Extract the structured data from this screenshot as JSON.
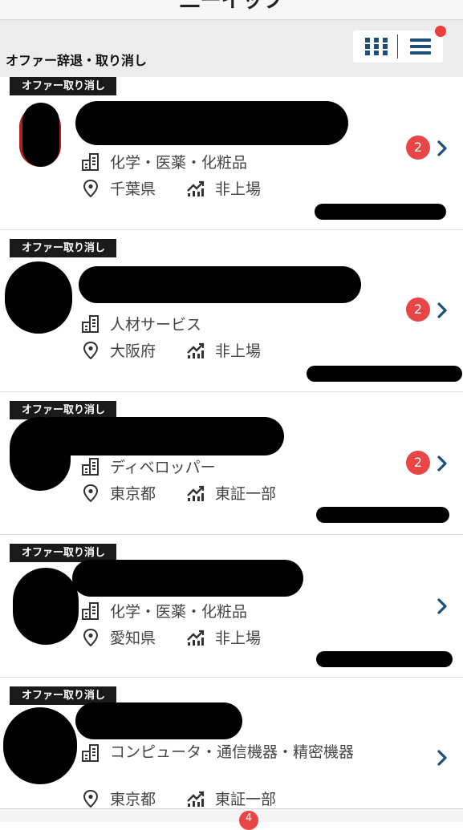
{
  "header": {
    "title": "二ーイップ"
  },
  "subheader": {
    "label": "オファー辞退・取り消し"
  },
  "colors": {
    "accent": "#1d4f7a",
    "badge": "#e84646",
    "tag_bg": "#1a1a1a"
  },
  "cards": [
    {
      "tag": "オファー取り消し",
      "industry": "化学・医薬・化粧品",
      "location": "千葉県",
      "listing": "非上場",
      "badge": "2"
    },
    {
      "tag": "オファー取り消し",
      "industry": "人材サービス",
      "location": "大阪府",
      "listing": "非上場",
      "badge": "2"
    },
    {
      "tag": "オファー取り消し",
      "industry": "ディベロッパー",
      "location": "東京都",
      "listing": "東証一部",
      "badge": "2"
    },
    {
      "tag": "オファー取り消し",
      "industry": "化学・医薬・化粧品",
      "location": "愛知県",
      "listing": "非上場",
      "badge": ""
    },
    {
      "tag": "オファー取り消し",
      "industry": "コンピュータ・通信機器・精密機器",
      "location": "東京都",
      "listing": "東証一部",
      "badge": ""
    }
  ],
  "bottom": {
    "badge": "4"
  },
  "icons": [
    "grid-icon",
    "menu-icon",
    "building-icon",
    "location-pin-icon",
    "trend-chart-icon",
    "chevron-right-icon"
  ]
}
